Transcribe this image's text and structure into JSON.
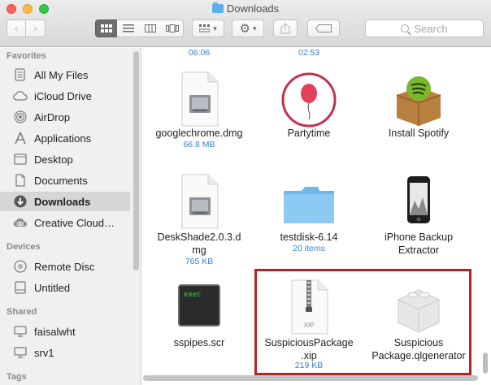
{
  "window": {
    "title": "Downloads"
  },
  "toolbar": {
    "search_placeholder": "Search"
  },
  "sidebar": {
    "sections": [
      {
        "heading": "Favorites"
      },
      {
        "heading": "Devices"
      },
      {
        "heading": "Shared"
      },
      {
        "heading": "Tags"
      }
    ],
    "favorites": [
      {
        "label": "All My Files",
        "icon": "all-files-icon"
      },
      {
        "label": "iCloud Drive",
        "icon": "cloud-icon"
      },
      {
        "label": "AirDrop",
        "icon": "airdrop-icon"
      },
      {
        "label": "Applications",
        "icon": "applications-icon"
      },
      {
        "label": "Desktop",
        "icon": "desktop-icon"
      },
      {
        "label": "Documents",
        "icon": "documents-icon"
      },
      {
        "label": "Downloads",
        "icon": "downloads-icon",
        "selected": true
      },
      {
        "label": "Creative Cloud…",
        "icon": "creative-cloud-icon"
      }
    ],
    "devices": [
      {
        "label": "Remote Disc",
        "icon": "disc-icon"
      },
      {
        "label": "Untitled",
        "icon": "drive-icon"
      }
    ],
    "shared": [
      {
        "label": "faisalwht",
        "icon": "computer-icon"
      },
      {
        "label": "srv1",
        "icon": "computer-icon"
      }
    ]
  },
  "files": {
    "row0": [
      {
        "name": "…",
        "meta": "06:06"
      },
      {
        "name": "…",
        "meta": "02:53"
      }
    ],
    "row1": [
      {
        "name": "googlechrome.dmg",
        "meta": "66.8 MB",
        "icon": "disk-image-icon"
      },
      {
        "name": "Partytime",
        "meta": "",
        "icon": "balloon-app-icon"
      },
      {
        "name": "Install Spotify",
        "meta": "",
        "icon": "spotify-installer-icon"
      }
    ],
    "row2": [
      {
        "name": "DeskShade2.0.3.d\nmg",
        "meta": "765 KB",
        "icon": "disk-image-icon"
      },
      {
        "name": "testdisk-6.14",
        "meta": "20 items",
        "icon": "folder-icon"
      },
      {
        "name": "iPhone Backup\nExtractor",
        "meta": "",
        "icon": "iphone-app-icon"
      }
    ],
    "row3": [
      {
        "name": "sspipes.scr",
        "meta": "",
        "icon": "terminal-exec-icon"
      },
      {
        "name": "SuspiciousPackage\n.xip",
        "meta": "219 KB",
        "icon": "xip-archive-icon"
      },
      {
        "name": "Suspicious\nPackage.qlgenerator",
        "meta": "",
        "icon": "plugin-icon"
      }
    ]
  },
  "icon_texts": {
    "exec": "exec",
    "xip": "XIP"
  },
  "colors": {
    "highlight": "#b92326",
    "meta": "#3a7fd0",
    "selected_sidebar": "#d6d6d6"
  }
}
